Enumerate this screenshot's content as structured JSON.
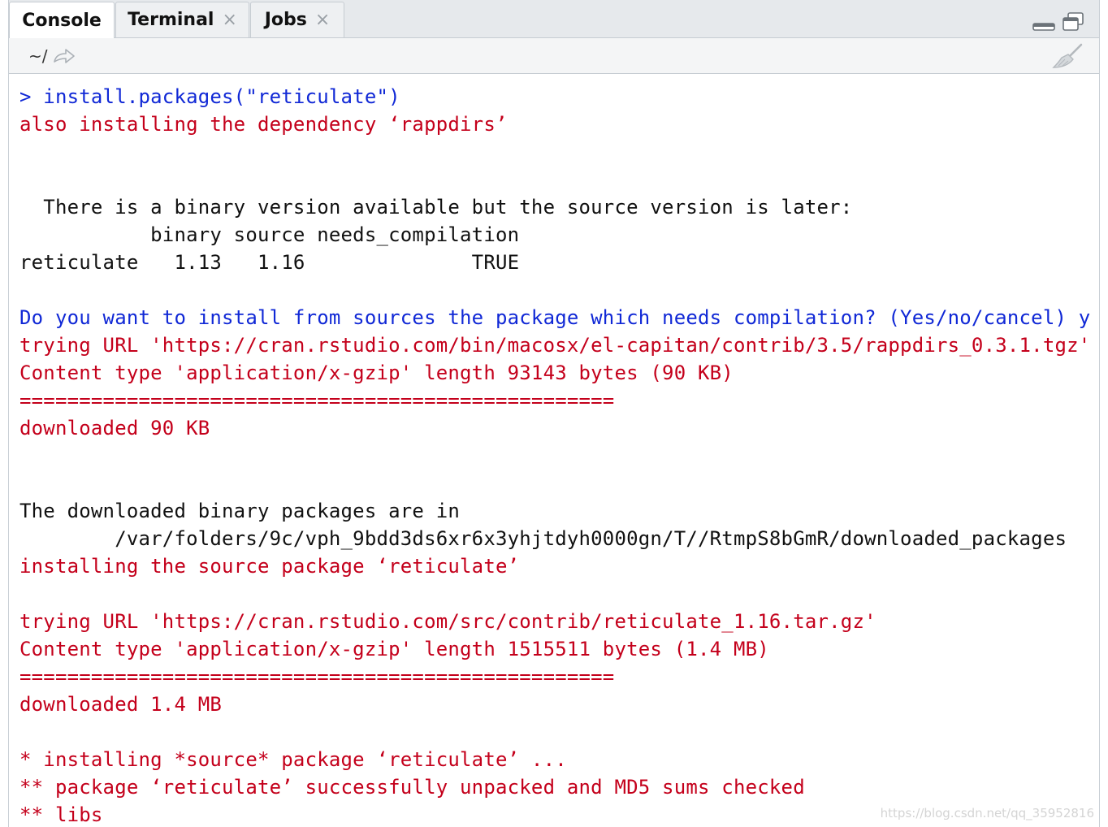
{
  "tabs": [
    {
      "label": "Console",
      "active": true,
      "closable": false
    },
    {
      "label": "Terminal",
      "active": false,
      "closable": true
    },
    {
      "label": "Jobs",
      "active": false,
      "closable": true
    }
  ],
  "toolbar": {
    "working_dir": "~/",
    "icons": [
      "go-to-directory-arrow-icon",
      "clear-console-broom-icon"
    ]
  },
  "colors": {
    "command": "#1028d6",
    "message": "#c4001b",
    "output": "#111111"
  },
  "console": {
    "lines": [
      {
        "style": "cmd",
        "text": "> install.packages(\"reticulate\")"
      },
      {
        "style": "msg",
        "text": "also installing the dependency ‘rappdirs’"
      },
      {
        "style": "out",
        "text": ""
      },
      {
        "style": "out",
        "text": ""
      },
      {
        "style": "out",
        "text": "  There is a binary version available but the source version is later:"
      },
      {
        "style": "out",
        "text": "           binary source needs_compilation"
      },
      {
        "style": "out",
        "text": "reticulate   1.13   1.16              TRUE"
      },
      {
        "style": "out",
        "text": ""
      },
      {
        "style": "cmd",
        "text": "Do you want to install from sources the package which needs compilation? (Yes/no/cancel) y"
      },
      {
        "style": "msg",
        "text": "trying URL 'https://cran.rstudio.com/bin/macosx/el-capitan/contrib/3.5/rappdirs_0.3.1.tgz'"
      },
      {
        "style": "msg",
        "text": "Content type 'application/x-gzip' length 93143 bytes (90 KB)"
      },
      {
        "style": "msg",
        "text": "=================================================="
      },
      {
        "style": "msg",
        "text": "downloaded 90 KB"
      },
      {
        "style": "out",
        "text": ""
      },
      {
        "style": "out",
        "text": ""
      },
      {
        "style": "out",
        "text": "The downloaded binary packages are in"
      },
      {
        "style": "out",
        "text": "        /var/folders/9c/vph_9bdd3ds6xr6x3yhjtdyh0000gn/T//RtmpS8bGmR/downloaded_packages"
      },
      {
        "style": "msg",
        "text": "installing the source package ‘reticulate’"
      },
      {
        "style": "out",
        "text": ""
      },
      {
        "style": "msg",
        "text": "trying URL 'https://cran.rstudio.com/src/contrib/reticulate_1.16.tar.gz'"
      },
      {
        "style": "msg",
        "text": "Content type 'application/x-gzip' length 1515511 bytes (1.4 MB)"
      },
      {
        "style": "msg",
        "text": "=================================================="
      },
      {
        "style": "msg",
        "text": "downloaded 1.4 MB"
      },
      {
        "style": "out",
        "text": ""
      },
      {
        "style": "msg",
        "text": "* installing *source* package ‘reticulate’ ..."
      },
      {
        "style": "msg",
        "text": "** package ‘reticulate’ successfully unpacked and MD5 sums checked"
      },
      {
        "style": "msg",
        "text": "** libs"
      }
    ]
  },
  "watermark": "https://blog.csdn.net/qq_35952816"
}
